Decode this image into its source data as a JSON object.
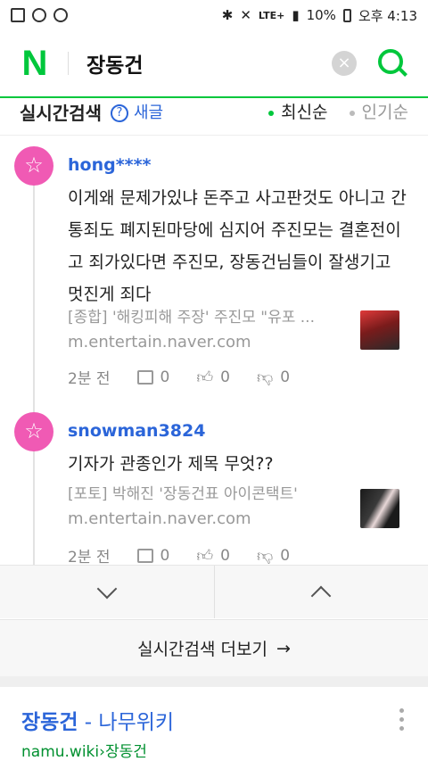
{
  "status_bar": {
    "battery": "10%",
    "time": "오후 4:13",
    "network": "LTE+"
  },
  "header": {
    "logo": "N",
    "query": "장동건",
    "clear_label": "×"
  },
  "section": {
    "title": "실시간검색",
    "help": "?",
    "refresh": "새글",
    "sort_new": "최신순",
    "sort_popular": "인기순"
  },
  "posts": [
    {
      "author": "hong****",
      "text": "이게왜 문제가있냐 돈주고 사고판것도 아니고 간통죄도 폐지된마당에 심지어 주진모는 결혼전이고 죄가있다면 주진모, 장동건님들이 잘생기고 멋진게 죄다",
      "source_title": "[종합] '해킹피해 주장' 주진모 \"유포 ...",
      "source_url": "m.entertain.naver.com",
      "time": "2분 전",
      "comments": "0",
      "likes": "0",
      "dislikes": "0"
    },
    {
      "author": "snowman3824",
      "text": "기자가 관종인가 제목 무엇??",
      "source_title": "[포토] 박해진 '장동건표 아이콘택트'",
      "source_url": "m.entertain.naver.com",
      "time": "2분 전",
      "comments": "0",
      "likes": "0",
      "dislikes": "0"
    }
  ],
  "more_button": "실시간검색 더보기",
  "result": {
    "keyword": "장동건",
    "suffix": " - 나무위키",
    "url_domain": "namu.wiki",
    "url_path": "장동건"
  },
  "colors": {
    "accent": "#00c73c",
    "link": "#2b65d9",
    "avatar": "#f05ab4"
  }
}
